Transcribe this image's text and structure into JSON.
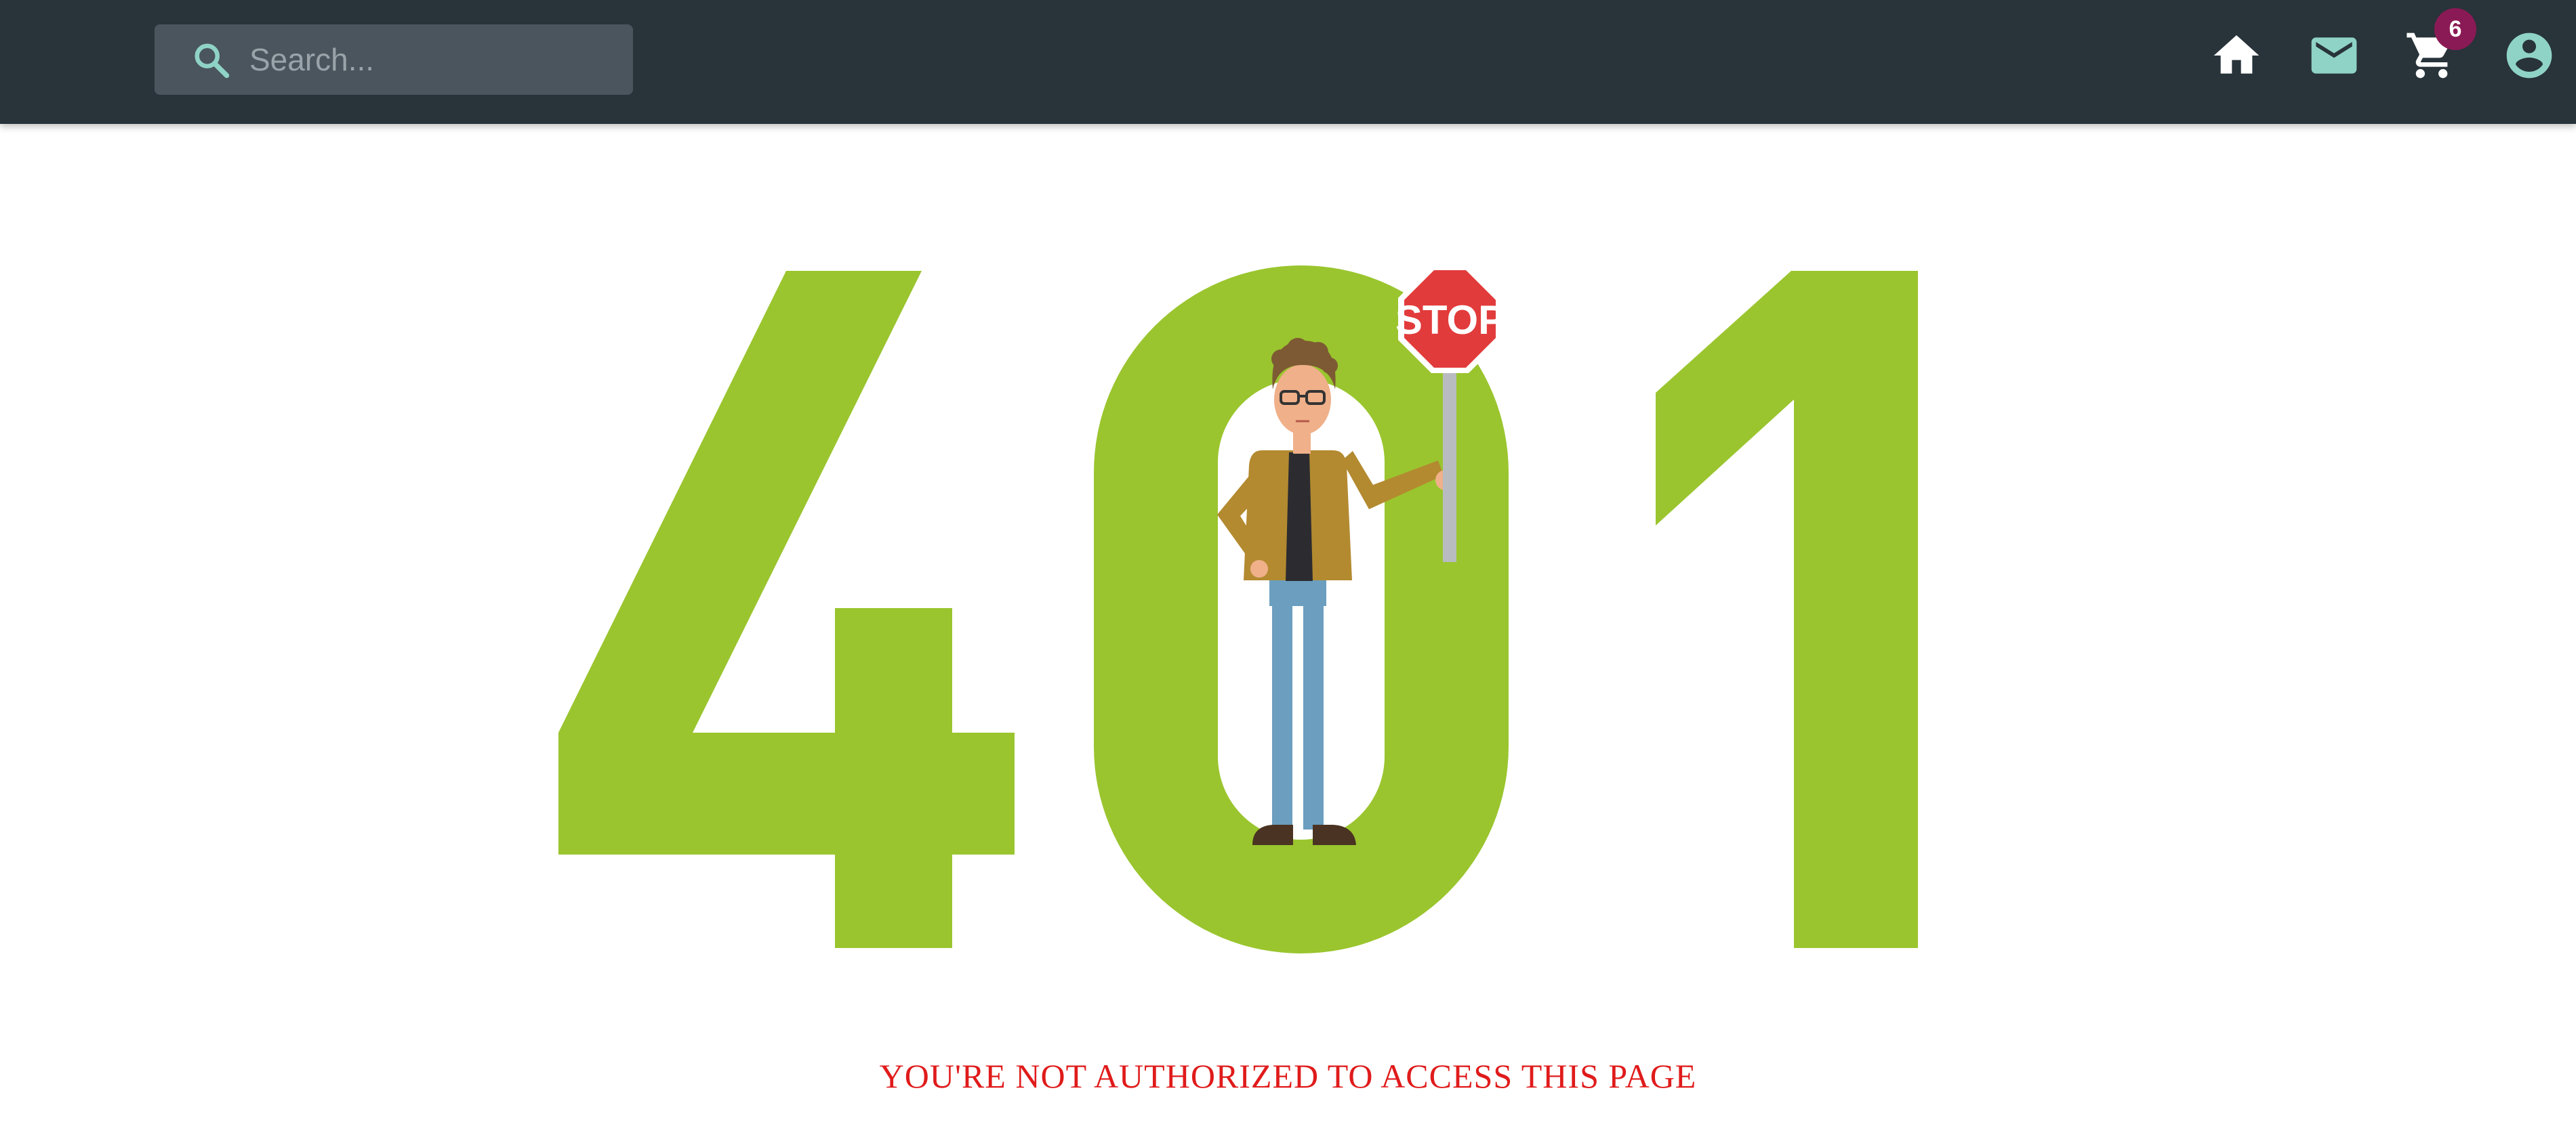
{
  "header": {
    "search": {
      "placeholder": "Search..."
    },
    "icons": [
      "home-icon",
      "mail-icon",
      "cart-icon",
      "account-icon"
    ],
    "cart_count": "6"
  },
  "error": {
    "code": "401",
    "sign_text": "STOP",
    "message": "YOU'RE NOT AUTHORIZED TO ACCESS THIS PAGE"
  },
  "colors": {
    "topbar": "#28333a",
    "search_bg": "#4a555d",
    "icon_teal": "#8fd3c6",
    "digits_green": "#9ac52e",
    "badge": "#8a1a55",
    "message_red": "#e01b1b"
  }
}
